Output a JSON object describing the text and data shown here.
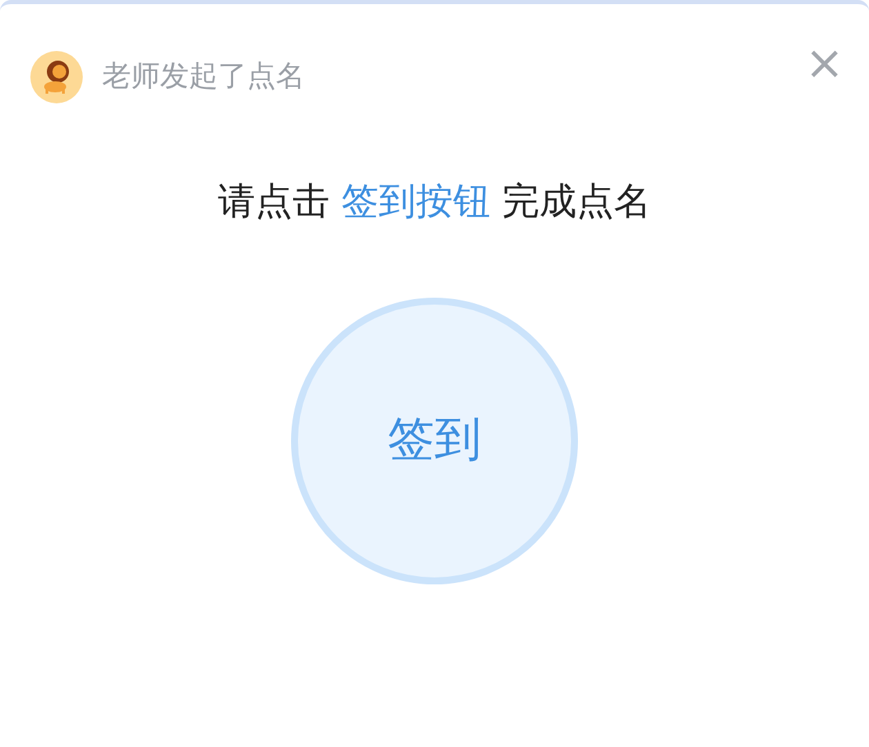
{
  "header": {
    "title": "老师发起了点名",
    "close": "×"
  },
  "instruction": {
    "before": "请点击",
    "link": "签到按钮",
    "after": "完成点名"
  },
  "checkin_button": {
    "label": "签到"
  }
}
